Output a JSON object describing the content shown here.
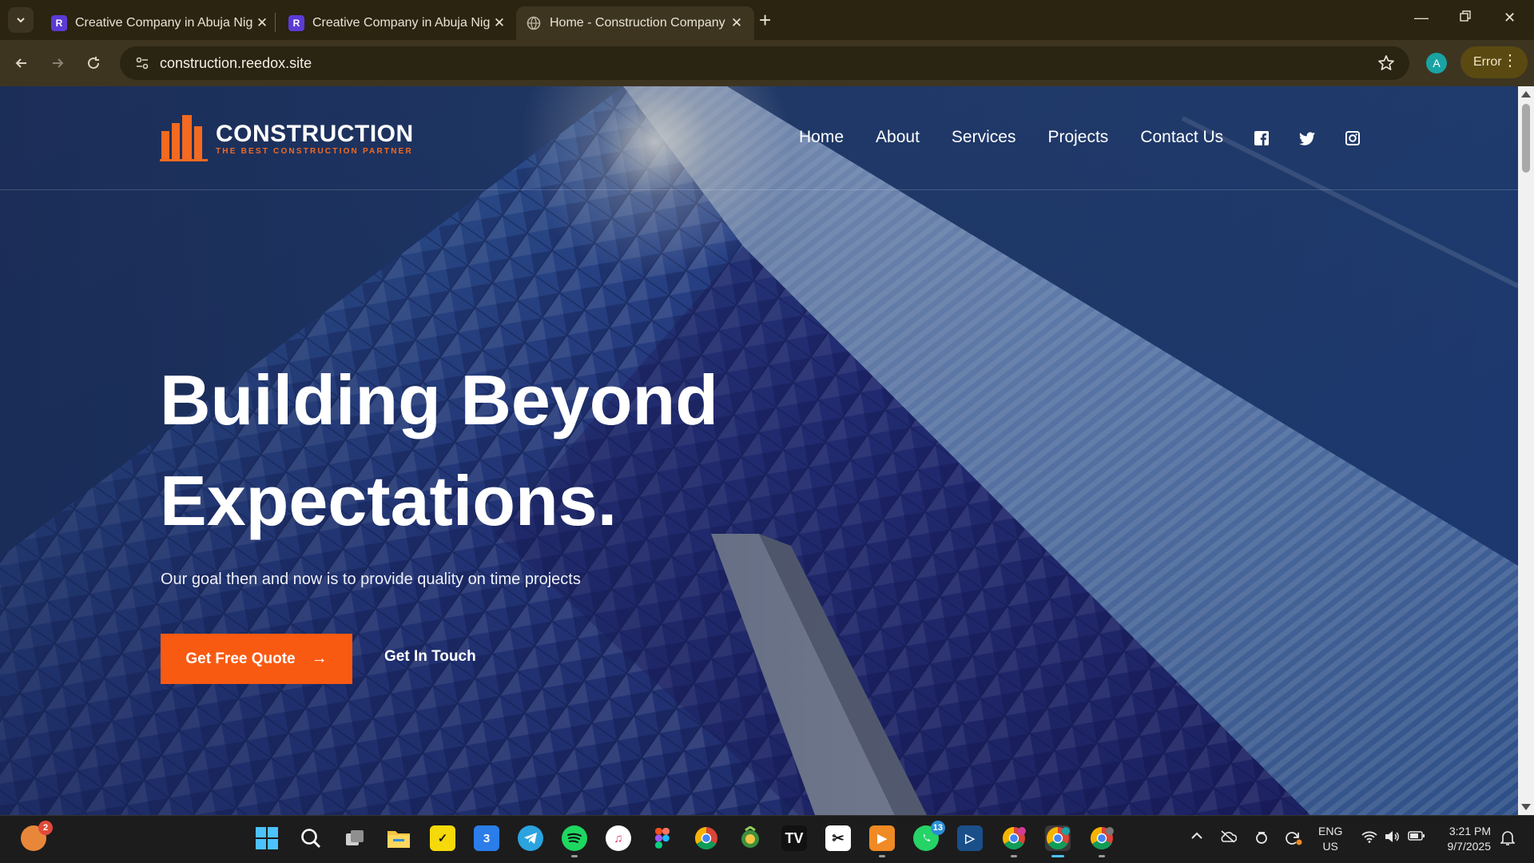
{
  "browser": {
    "tabs": [
      {
        "title": "Creative Company in Abuja Nig",
        "favicon": "reedox-logo-icon",
        "active": false
      },
      {
        "title": "Creative Company in Abuja Nig",
        "favicon": "reedox-logo-icon",
        "active": false
      },
      {
        "title": "Home - Construction Company",
        "favicon": "globe-icon",
        "active": true
      }
    ],
    "url": "construction.reedox.site",
    "profile_initial": "A",
    "error_label": "Error"
  },
  "site": {
    "logo": {
      "name": "CONSTRUCTION",
      "tagline": "THE BEST CONSTRUCTION PARTNER"
    },
    "nav": [
      "Home",
      "About",
      "Services",
      "Projects",
      "Contact Us"
    ],
    "socials": [
      "facebook-icon",
      "twitter-icon",
      "instagram-icon"
    ],
    "hero": {
      "title_line1": "Building Beyond",
      "title_line2": "Expectations.",
      "subtitle": "Our goal then and now is to provide quality on time projects",
      "cta_primary": "Get Free Quote",
      "cta_secondary": "Get In Touch"
    },
    "colors": {
      "accent": "#f95a12",
      "logo_accent": "#f36a20"
    }
  },
  "taskbar": {
    "weather_badge": "2",
    "whatsapp_badge": "13",
    "apps": [
      "widgets-weather",
      "start-icon",
      "search-icon",
      "task-view-icon",
      "file-explorer-icon",
      "norton-icon",
      "three-icon",
      "telegram-icon",
      "spotify-icon",
      "itunes-icon",
      "figma-icon",
      "chrome-icon",
      "money-icon",
      "tradingview-icon",
      "capcut-icon",
      "video-player-icon",
      "whatsapp-icon",
      "edge-app-icon",
      "chrome-profile-v-icon",
      "chrome-profile-a-icon",
      "chrome-profile-guest-icon"
    ],
    "lang_line1": "ENG",
    "lang_line2": "US",
    "time": "3:21 PM",
    "date": "9/7/2025"
  }
}
